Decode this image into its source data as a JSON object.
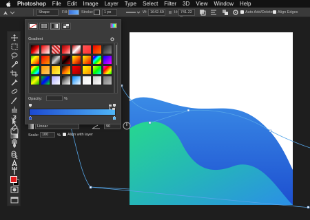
{
  "menubar": {
    "items": [
      "Photoshop",
      "File",
      "Edit",
      "Image",
      "Layer",
      "Type",
      "Select",
      "Filter",
      "3D",
      "View",
      "Window",
      "Help"
    ]
  },
  "options": {
    "mode": "Shape",
    "fill_label": "Fill:",
    "stroke_label": "Stroke:",
    "stroke_width": "1 px",
    "w_label": "W:",
    "w_value": "1642.69",
    "h_label": "H:",
    "h_value": "741.22 p",
    "auto_add_delete": "Auto Add/Delete",
    "align_edges": "Align Edges"
  },
  "gradient_panel": {
    "section_label": "Gradient",
    "opacity_label": "Opacity:",
    "opacity_unit": "%",
    "style": "Linear",
    "angle": "90",
    "scale_label": "Scale:",
    "scale": "100",
    "scale_unit": "%",
    "align_with_layer": "Align with layer",
    "ramp_colors": [
      "#1c49d0",
      "#4fb5f7"
    ]
  },
  "colors": {
    "foreground": "#e0191b",
    "background": "#000000",
    "wave_top": [
      "#2a6fd8",
      "#2f9be8"
    ],
    "wave_front": [
      "#22c08a",
      "#2f9fe0"
    ]
  }
}
